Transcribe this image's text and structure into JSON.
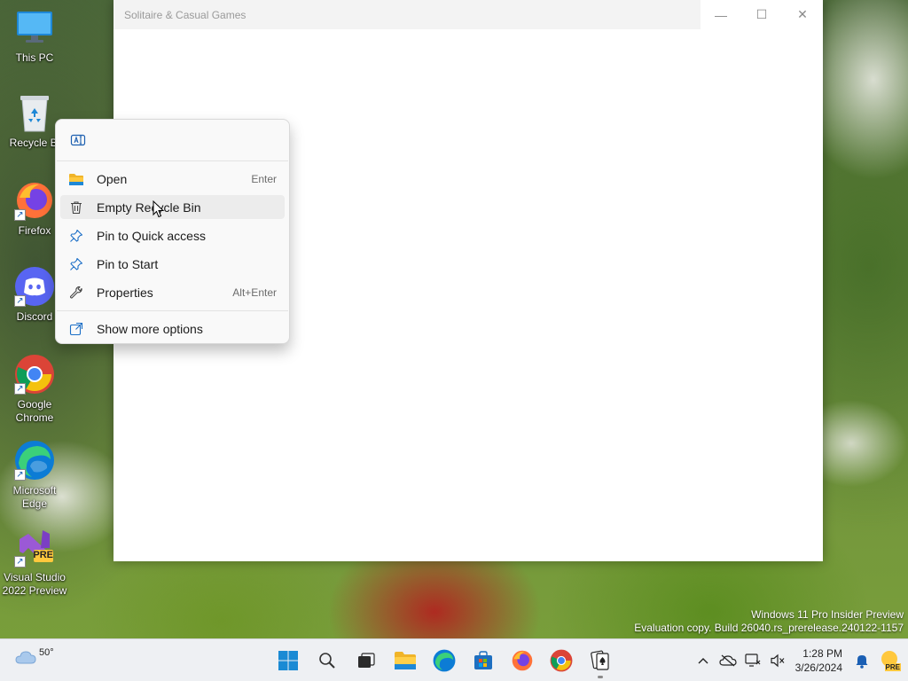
{
  "desktop": {
    "icons": [
      {
        "label": "This PC",
        "icon": "this-pc-icon"
      },
      {
        "label": "Recycle Bi",
        "icon": "recycle-bin-icon"
      },
      {
        "label": "Firefox",
        "icon": "firefox-icon"
      },
      {
        "label": "Discord",
        "icon": "discord-icon"
      },
      {
        "label_line1": "Google",
        "label_line2": "Chrome",
        "icon": "chrome-icon"
      },
      {
        "label_line1": "Microsoft",
        "label_line2": "Edge",
        "icon": "edge-icon"
      },
      {
        "label_line1": "Visual Studio",
        "label_line2": "2022 Preview",
        "icon": "visual-studio-icon",
        "badge": "PRE"
      }
    ]
  },
  "window": {
    "title": "Solitaire & Casual Games",
    "controls": {
      "minimize": "—",
      "maximize": "☐",
      "close": "✕"
    }
  },
  "context_menu": {
    "top_icon": "rename-icon",
    "items": [
      {
        "label": "Open",
        "accelerator": "Enter",
        "icon": "folder-icon"
      },
      {
        "label": "Empty Recycle Bin",
        "accelerator": "",
        "icon": "trash-icon",
        "hovered": true
      },
      {
        "label": "Pin to Quick access",
        "accelerator": "",
        "icon": "pin-icon"
      },
      {
        "label": "Pin to Start",
        "accelerator": "",
        "icon": "pin-icon"
      },
      {
        "label": "Properties",
        "accelerator": "Alt+Enter",
        "icon": "wrench-icon"
      }
    ],
    "more": {
      "label": "Show more options",
      "icon": "share-icon"
    }
  },
  "watermark": {
    "line1": "Windows 11 Pro Insider Preview",
    "line2": "Evaluation copy. Build 26040.rs_prerelease.240122-1157"
  },
  "taskbar": {
    "weather": {
      "temp": "50°",
      "icon": "cloud-icon"
    },
    "apps": [
      "start-icon",
      "search-icon",
      "task-view-icon",
      "file-explorer-icon",
      "edge-icon",
      "store-icon",
      "firefox-icon",
      "chrome-icon",
      "solitaire-icon"
    ],
    "clock": {
      "time": "1:28 PM",
      "date": "3/26/2024"
    },
    "tray_badge": "PRE"
  },
  "colors": {
    "accent": "#0067c0",
    "menu_bg": "#f9f9f9",
    "hover_bg": "#ececec",
    "taskbar_bg": "#eef0f3"
  }
}
